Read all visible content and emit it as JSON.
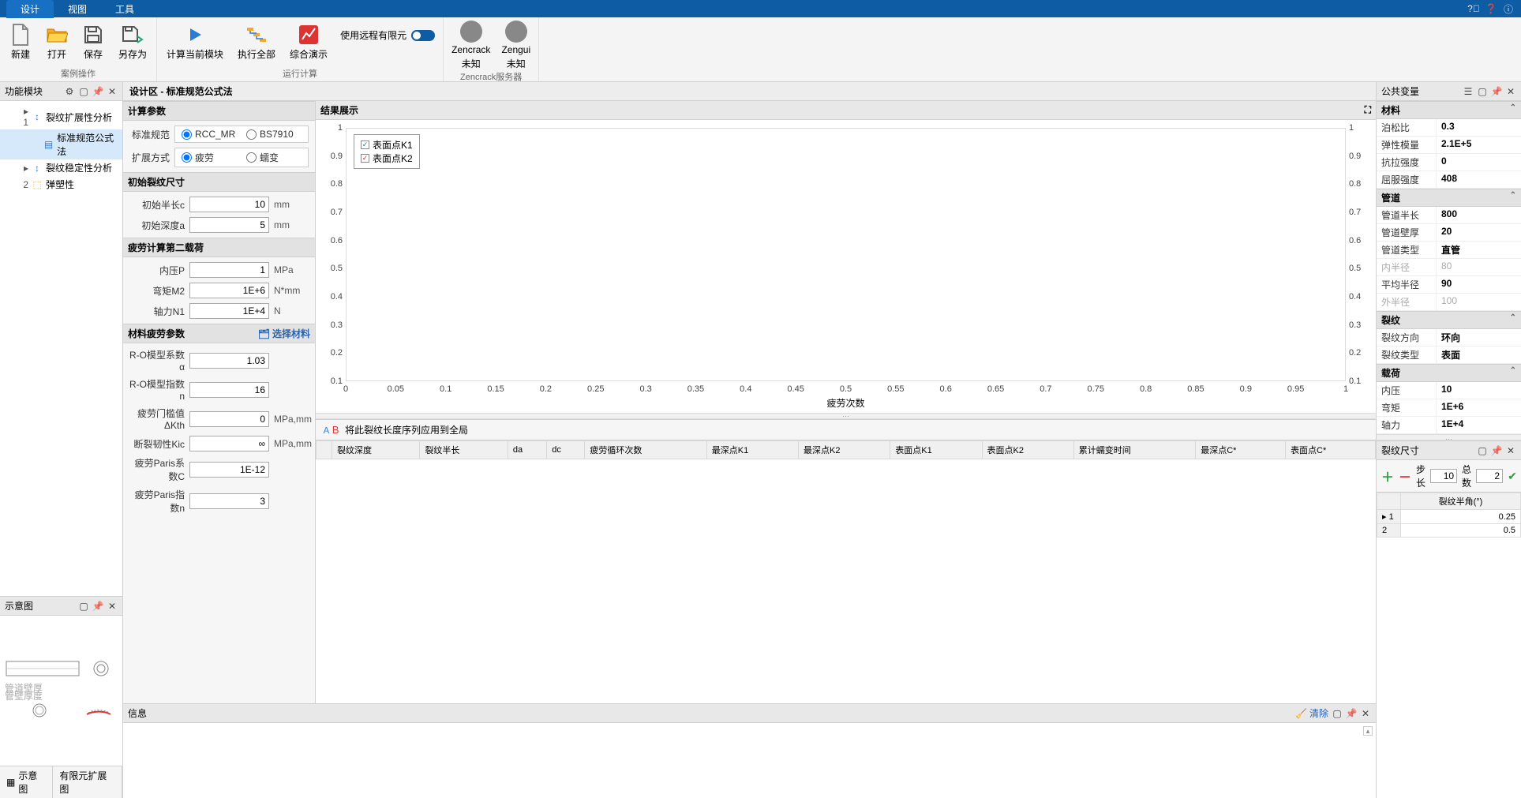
{
  "menubar": {
    "tabs": [
      "设计",
      "视图",
      "工具"
    ],
    "active": 0
  },
  "ribbon": {
    "groups": [
      {
        "label": "案例操作",
        "items": [
          {
            "name": "new",
            "label": "新建",
            "icon": "file"
          },
          {
            "name": "open",
            "label": "打开",
            "icon": "folder"
          },
          {
            "name": "save",
            "label": "保存",
            "icon": "disk"
          },
          {
            "name": "saveas",
            "label": "另存为",
            "icon": "disk-arrow"
          }
        ]
      },
      {
        "label": "运行计算",
        "items": [
          {
            "name": "run-current",
            "label": "计算当前模块",
            "icon": "play"
          },
          {
            "name": "run-all",
            "label": "执行全部",
            "icon": "steps"
          },
          {
            "name": "demo",
            "label": "综合演示",
            "icon": "chart"
          }
        ],
        "toggle": {
          "label": "使用远程有限元",
          "on": false
        }
      },
      {
        "label": "Zencrack服务器",
        "items": [
          {
            "name": "zencrack",
            "label1": "Zencrack",
            "label2": "未知"
          },
          {
            "name": "zengui",
            "label1": "Zengui",
            "label2": "未知"
          }
        ]
      }
    ]
  },
  "left_panel": {
    "title": "功能模块",
    "tree": [
      {
        "num": "1",
        "expander": "▸",
        "label": "裂纹扩展性分析",
        "level": 1,
        "icon": "expand"
      },
      {
        "num": "",
        "expander": "",
        "label": "标准规范公式法",
        "level": 2,
        "icon": "std",
        "selected": true
      },
      {
        "num": "",
        "expander": "▸",
        "label": "裂纹稳定性分析",
        "level": 1,
        "icon": "expand"
      },
      {
        "num": "2",
        "expander": "",
        "label": "弹塑性",
        "level": 1,
        "icon": "ep"
      }
    ],
    "schematic": {
      "title": "示意图",
      "tabs": [
        "示意图",
        "有限元扩展图"
      ]
    }
  },
  "design_area": {
    "title": "设计区 - 标准规范公式法",
    "sections": {
      "calc_params": {
        "title": "计算参数",
        "std_label": "标准规范",
        "std_opts": [
          "RCC_MR",
          "BS7910"
        ],
        "std_sel": 0,
        "method_label": "扩展方式",
        "method_opts": [
          "疲劳",
          "蠕变"
        ],
        "method_sel": 0
      },
      "init_crack": {
        "title": "初始裂纹尺寸",
        "fields": [
          {
            "label": "初始半长c",
            "value": "10",
            "unit": "mm"
          },
          {
            "label": "初始深度a",
            "value": "5",
            "unit": "mm"
          }
        ]
      },
      "fatigue_load": {
        "title": "疲劳计算第二载荷",
        "fields": [
          {
            "label": "内压P",
            "value": "1",
            "unit": "MPa"
          },
          {
            "label": "弯矩M2",
            "value": "1E+6",
            "unit": "N*mm"
          },
          {
            "label": "轴力N1",
            "value": "1E+4",
            "unit": "N"
          }
        ]
      },
      "material": {
        "title": "材料疲劳参数",
        "link": "选择材料",
        "fields": [
          {
            "label": "R-O模型系数α",
            "value": "1.03",
            "unit": ""
          },
          {
            "label": "R-O模型指数n",
            "value": "16",
            "unit": ""
          },
          {
            "label": "疲劳门槛值ΔKth",
            "value": "0",
            "unit": "MPa,mm"
          },
          {
            "label": "断裂韧性Kic",
            "value": "∞",
            "unit": "MPa,mm"
          },
          {
            "label": "疲劳Paris系数C",
            "value": "1E-12",
            "unit": ""
          },
          {
            "label": "疲劳Paris指数n",
            "value": "3",
            "unit": ""
          }
        ]
      }
    }
  },
  "results": {
    "title": "结果展示",
    "apply_label": "将此裂纹长度序列应用到全局",
    "table_headers": [
      "裂纹深度",
      "裂纹半长",
      "da",
      "dc",
      "疲劳循环次数",
      "最深点K1",
      "最深点K2",
      "表面点K1",
      "表面点K2",
      "累计蠕变时间",
      "最深点C*",
      "表面点C*"
    ]
  },
  "chart_data": {
    "type": "line",
    "title": "",
    "xlabel": "疲劳次数",
    "ylabel": "",
    "xlim": [
      0,
      1
    ],
    "ylim_left": [
      0.1,
      1
    ],
    "ylim_right": [
      0.1,
      1
    ],
    "x_ticks": [
      0,
      0.05,
      0.1,
      0.15,
      0.2,
      0.25,
      0.3,
      0.35,
      0.4,
      0.45,
      0.5,
      0.55,
      0.6,
      0.65,
      0.7,
      0.75,
      0.8,
      0.85,
      0.9,
      0.95,
      1
    ],
    "y_ticks_left": [
      0.1,
      0.2,
      0.3,
      0.4,
      0.5,
      0.6,
      0.7,
      0.8,
      0.9,
      1
    ],
    "y_ticks_right": [
      0.1,
      0.2,
      0.3,
      0.4,
      0.5,
      0.6,
      0.7,
      0.8,
      0.9,
      1
    ],
    "series": [
      {
        "name": "表面点K1",
        "color": "#1f77b4",
        "values": [],
        "checked": true
      },
      {
        "name": "表面点K2",
        "color": "#d62728",
        "values": [],
        "checked": true
      }
    ]
  },
  "info_panel": {
    "title": "信息",
    "clear_label": "清除"
  },
  "public_vars": {
    "title": "公共变量",
    "sections": [
      {
        "title": "材料",
        "rows": [
          {
            "name": "泊松比",
            "value": "0.3"
          },
          {
            "name": "弹性模量",
            "value": "2.1E+5"
          },
          {
            "name": "抗拉强度",
            "value": "0"
          },
          {
            "name": "屈服强度",
            "value": "408"
          }
        ]
      },
      {
        "title": "管道",
        "rows": [
          {
            "name": "管道半长",
            "value": "800"
          },
          {
            "name": "管道壁厚",
            "value": "20"
          },
          {
            "name": "管道类型",
            "value": "直管"
          },
          {
            "name": "内半径",
            "value": "80",
            "dim": true
          },
          {
            "name": "平均半径",
            "value": "90"
          },
          {
            "name": "外半径",
            "value": "100",
            "dim": true
          }
        ]
      },
      {
        "title": "裂纹",
        "rows": [
          {
            "name": "裂纹方向",
            "value": "环向"
          },
          {
            "name": "裂纹类型",
            "value": "表面"
          }
        ]
      },
      {
        "title": "载荷",
        "rows": [
          {
            "name": "内压",
            "value": "10"
          },
          {
            "name": "弯矩",
            "value": "1E+6"
          },
          {
            "name": "轴力",
            "value": "1E+4"
          }
        ]
      }
    ]
  },
  "crack_size": {
    "title": "裂纹尺寸",
    "step_label": "步长",
    "step_value": "10",
    "total_label": "总数",
    "total_value": "2",
    "col_header": "裂纹半角(°)",
    "rows": [
      {
        "idx": "1",
        "val": "0.25",
        "marker": "▸"
      },
      {
        "idx": "2",
        "val": "0.5",
        "marker": ""
      }
    ]
  }
}
